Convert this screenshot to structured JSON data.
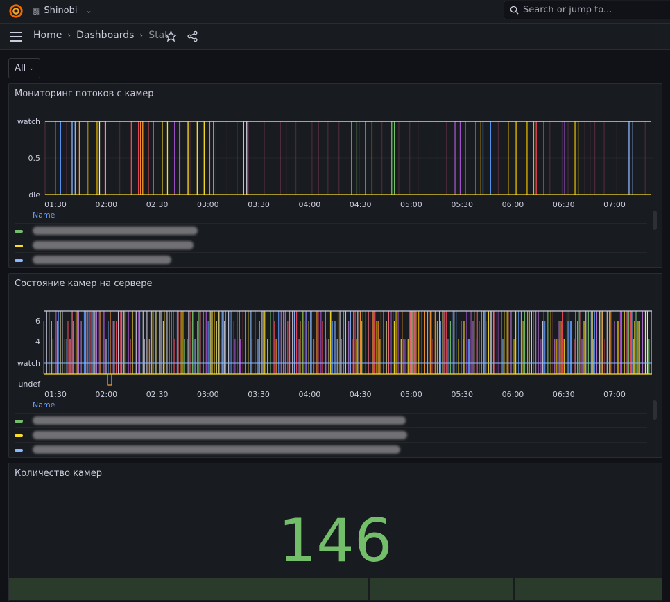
{
  "header": {
    "org_name": "Shinobi",
    "search_placeholder": "Search or jump to..."
  },
  "breadcrumb": {
    "home": "Home",
    "dashboards": "Dashboards",
    "current": "Stat"
  },
  "variable": {
    "value": "All"
  },
  "panels": [
    {
      "title": "Мониторинг потоков с камер",
      "legend_header": "Name",
      "y_ticks": [
        "watch",
        "0.5",
        "die"
      ],
      "x_ticks": [
        "01:30",
        "02:00",
        "02:30",
        "03:00",
        "03:30",
        "04:00",
        "04:30",
        "05:00",
        "05:30",
        "06:00",
        "06:30",
        "07:00"
      ],
      "legend_colors": [
        "#73bf69",
        "#fade2a",
        "#8ab8ff"
      ]
    },
    {
      "title": "Состояние камер на сервере",
      "legend_header": "Name",
      "y_ticks": [
        "6",
        "4",
        "watch",
        "undef"
      ],
      "x_ticks": [
        "01:30",
        "02:00",
        "02:30",
        "03:00",
        "03:30",
        "04:00",
        "04:30",
        "05:00",
        "05:30",
        "06:00",
        "06:30",
        "07:00"
      ],
      "legend_colors": [
        "#73bf69",
        "#fade2a",
        "#8ab8ff"
      ]
    },
    {
      "title": "Количество камер",
      "value": "146",
      "value_color": "#73bf69"
    }
  ],
  "chart_data": [
    {
      "type": "line",
      "title": "Мониторинг потоков с камер",
      "ylabel": "",
      "yticks": [
        "die",
        "0.5",
        "watch"
      ],
      "xticks": [
        "01:30",
        "02:00",
        "02:30",
        "03:00",
        "03:30",
        "04:00",
        "04:30",
        "05:00",
        "05:30",
        "06:00",
        "06:30",
        "07:00"
      ]
    },
    {
      "type": "line",
      "title": "Состояние камер на сервере",
      "ylabel": "",
      "yticks": [
        "undef",
        "watch",
        "4",
        "6"
      ],
      "xticks": [
        "01:30",
        "02:00",
        "02:30",
        "03:00",
        "03:30",
        "04:00",
        "04:30",
        "05:00",
        "05:30",
        "06:00",
        "06:30",
        "07:00"
      ]
    }
  ]
}
